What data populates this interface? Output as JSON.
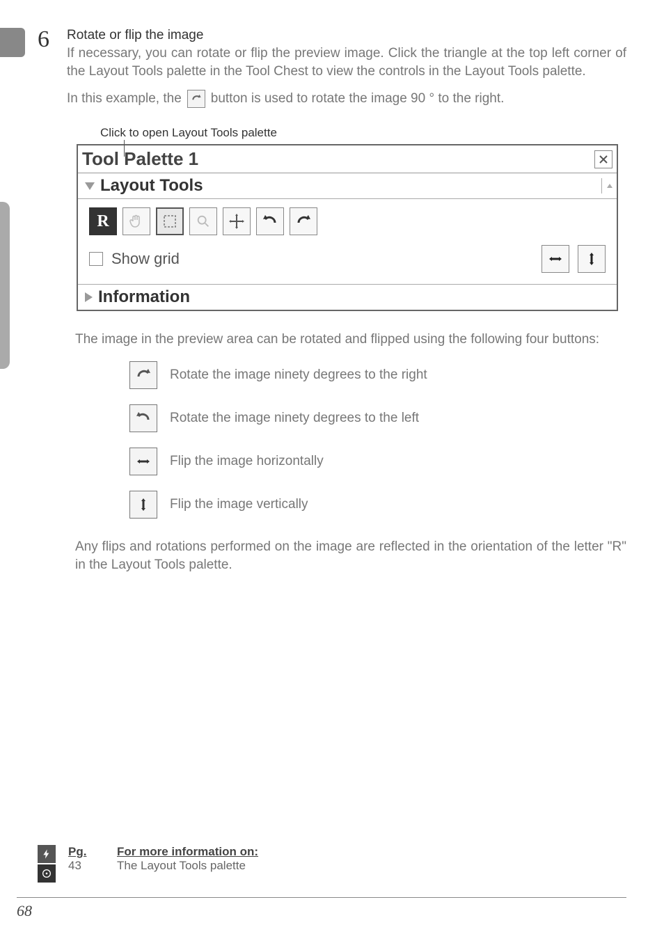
{
  "step": {
    "number": "6",
    "title": "Rotate or flip the image",
    "body": "If necessary, you can rotate or flip the preview image.  Click the triangle at the top left corner of the Layout Tools palette in the Tool Chest to view the controls in the Layout Tools palette.",
    "inline_a": "In this example, the",
    "inline_b": "button is used to rotate the image 90 ° to the right."
  },
  "caption": "Click to open Layout Tools palette",
  "palette": {
    "title": "Tool Palette 1",
    "section_layout": "Layout Tools",
    "section_info": "Information",
    "r_indicator": "R",
    "show_grid": "Show grid"
  },
  "after_palette": "The image in the preview area can be rotated and flipped using the following four buttons:",
  "icons": {
    "rotate_right": "Rotate the image ninety degrees to the right",
    "rotate_left": "Rotate the image ninety degrees to the left",
    "flip_h": "Flip the image horizontally",
    "flip_v": "Flip the image vertically"
  },
  "closing": "Any flips and rotations performed on the image are reflected in the orientation of the letter \"R\" in the Layout Tools palette.",
  "ref": {
    "pg_label": "Pg.",
    "info_label": "For more information on:",
    "page": "43",
    "topic": "The Layout Tools palette"
  },
  "page_number": "68"
}
